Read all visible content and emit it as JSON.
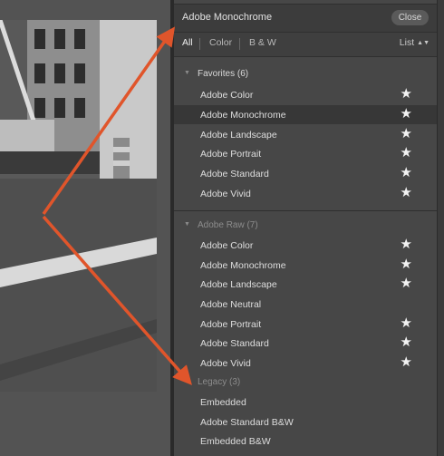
{
  "header": {
    "title": "Adobe Monochrome",
    "close_label": "Close"
  },
  "filter_bar": {
    "all": "All",
    "color": "Color",
    "bw": "B & W",
    "list": "List"
  },
  "groups": [
    {
      "name": "Favorites (6)",
      "items": [
        {
          "label": "Adobe Color",
          "starred": true
        },
        {
          "label": "Adobe Monochrome",
          "starred": true,
          "selected": true
        },
        {
          "label": "Adobe Landscape",
          "starred": true
        },
        {
          "label": "Adobe Portrait",
          "starred": true
        },
        {
          "label": "Adobe Standard",
          "starred": true
        },
        {
          "label": "Adobe Vivid",
          "starred": true
        }
      ]
    },
    {
      "name": "Adobe Raw (7)",
      "items": [
        {
          "label": "Adobe Color",
          "starred": true
        },
        {
          "label": "Adobe Monochrome",
          "starred": true
        },
        {
          "label": "Adobe Landscape",
          "starred": true
        },
        {
          "label": "Adobe Neutral",
          "starred": false
        },
        {
          "label": "Adobe Portrait",
          "starred": true
        },
        {
          "label": "Adobe Standard",
          "starred": true
        },
        {
          "label": "Adobe Vivid",
          "starred": true
        }
      ]
    },
    {
      "name": "Legacy (3)",
      "items": [
        {
          "label": "Embedded",
          "starred": false
        },
        {
          "label": "Adobe Standard B&W",
          "starred": false
        },
        {
          "label": "Embedded B&W",
          "starred": false
        }
      ]
    }
  ],
  "icons": {
    "star": "star-icon",
    "triangle": "disclosure-triangle-icon"
  },
  "colors": {
    "arrow": "#e0552b",
    "panel_bg": "#474747",
    "selected_row": "#373737",
    "header_bg": "#3c3c3c"
  }
}
